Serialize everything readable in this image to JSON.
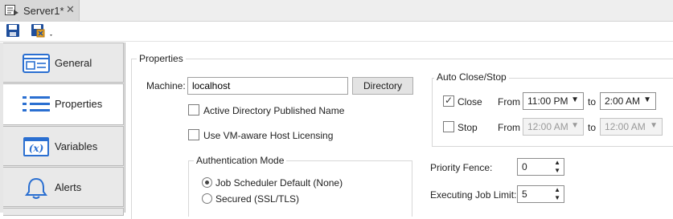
{
  "tab": {
    "title": "Server1*",
    "close": "✕"
  },
  "nav": {
    "items": [
      {
        "label": "General"
      },
      {
        "label": "Properties"
      },
      {
        "label": "Variables"
      },
      {
        "label": "Alerts"
      }
    ]
  },
  "properties": {
    "group_label": "Properties",
    "machine_label": "Machine:",
    "machine_value": "localhost",
    "directory_button": "Directory",
    "active_directory_label": "Active Directory Published Name",
    "vm_licensing_label": "Use VM-aware Host Licensing",
    "auth": {
      "label": "Authentication Mode",
      "options": [
        {
          "label": "Job Scheduler Default (None)"
        },
        {
          "label": "Secured (SSL/TLS)"
        }
      ]
    }
  },
  "auto_close_stop": {
    "label": "Auto Close/Stop",
    "close": {
      "label": "Close",
      "from_label": "From",
      "from": "11:00 PM",
      "to_label": "to",
      "to": "2:00 AM"
    },
    "stop": {
      "label": "Stop",
      "from_label": "From",
      "from": "12:00 AM",
      "to_label": "to",
      "to": "12:00 AM"
    }
  },
  "priority_fence": {
    "label": "Priority Fence:",
    "value": "0"
  },
  "executing_job_limit": {
    "label": "Executing Job Limit:",
    "value": "5"
  },
  "colors": {
    "accent": "#2a6fd1",
    "nav_bg": "#e6e6e6",
    "save_orange": "#e6a020"
  }
}
